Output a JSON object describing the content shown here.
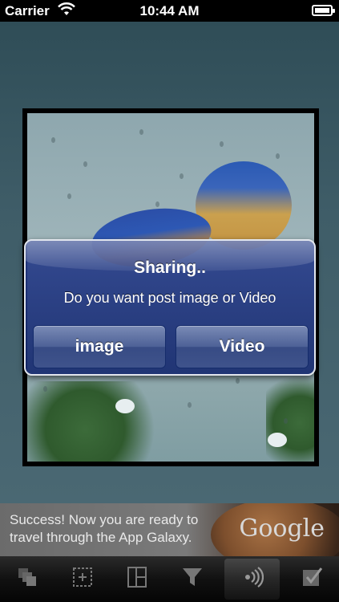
{
  "status_bar": {
    "carrier": "Carrier",
    "time": "10:44 AM",
    "wifi_icon": "wifi-icon",
    "battery_icon": "battery-icon"
  },
  "alert": {
    "title": "Sharing..",
    "message": "Do you want post image or Video",
    "buttons": [
      {
        "label": "image"
      },
      {
        "label": "Video"
      }
    ]
  },
  "ad_banner": {
    "text": "Success! Now you are ready to travel through the App Galaxy.",
    "logo": "Google"
  },
  "tab_bar": {
    "items": [
      {
        "icon": "layers-icon"
      },
      {
        "icon": "crop-icon"
      },
      {
        "icon": "layout-icon"
      },
      {
        "icon": "filter-icon"
      },
      {
        "icon": "share-broadcast-icon",
        "active": true
      },
      {
        "icon": "checkbox-icon"
      }
    ]
  }
}
